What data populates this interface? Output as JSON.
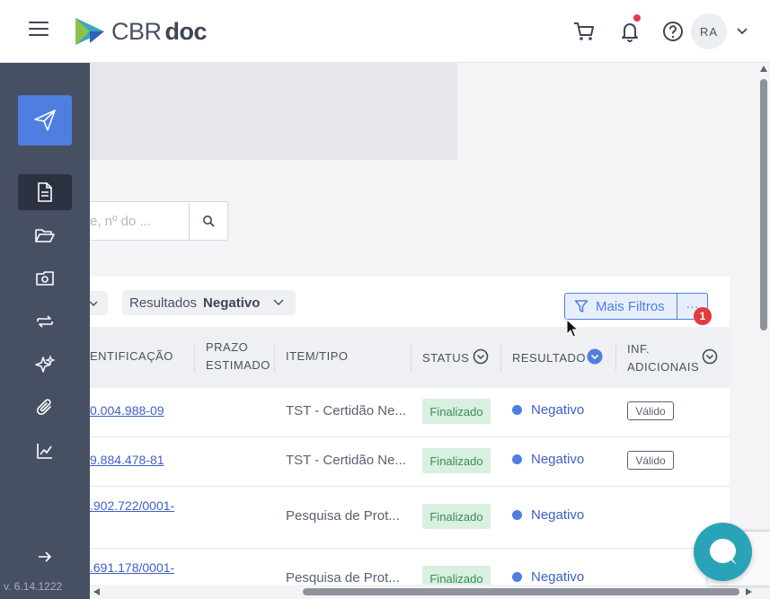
{
  "header": {
    "logo_text": "CBR",
    "logo_bold": "doc",
    "avatar_initials": "RA",
    "icons": [
      "menu-icon",
      "cart-icon",
      "bell-icon",
      "help-icon",
      "chevron-down-icon"
    ],
    "notification_dot_color": "#e8394d"
  },
  "sidebar": {
    "version": "v. 6.14.1222",
    "items": [
      {
        "icon": "send-icon"
      },
      {
        "icon": "document-icon",
        "active": true
      },
      {
        "icon": "folder-open-icon"
      },
      {
        "icon": "monitor-icon"
      },
      {
        "icon": "refresh-icon"
      },
      {
        "icon": "sparkle-icon"
      },
      {
        "icon": "paperclip-icon"
      },
      {
        "icon": "chart-line-icon"
      },
      {
        "icon": "arrow-right-icon"
      }
    ],
    "accent_color": "#4e7ee0",
    "background_color": "#474f63"
  },
  "search": {
    "placeholder": "e, nº do ..."
  },
  "filters": {
    "result_label": "Resultados",
    "result_value": "Negativo",
    "more_filters_label": "Mais Filtros",
    "more_dots": "···",
    "badge_count": "1"
  },
  "table": {
    "headers": {
      "identification": "ENTIFICAÇÃO",
      "deadline_line1": "PRAZO",
      "deadline_line2": "ESTIMADO",
      "item_type": "ITEM/TIPO",
      "status": "STATUS",
      "result": "RESULTADO",
      "info_line1": "INF.",
      "info_line2": "ADICIONAIS"
    },
    "rows": [
      {
        "id_line1": "0.004.988-09",
        "id_line2": "",
        "item": "TST - Certidão Ne...",
        "status": "Finalizado",
        "result": "Negativo",
        "extra": "Válido"
      },
      {
        "id_line1": "9.884.478-81",
        "id_line2": "",
        "item": "TST - Certidão Ne...",
        "status": "Finalizado",
        "result": "Negativo",
        "extra": "Válido"
      },
      {
        "id_line1": ".902.722/0001-",
        "id_line2": "",
        "item": "Pesquisa de Prot...",
        "status": "Finalizado",
        "result": "Negativo",
        "extra": ""
      },
      {
        "id_line1": ".691.178/0001-",
        "id_line2": "",
        "item": "Pesquisa de Prot...",
        "status": "Finalizado",
        "result": "Negativo",
        "extra": ""
      }
    ]
  }
}
